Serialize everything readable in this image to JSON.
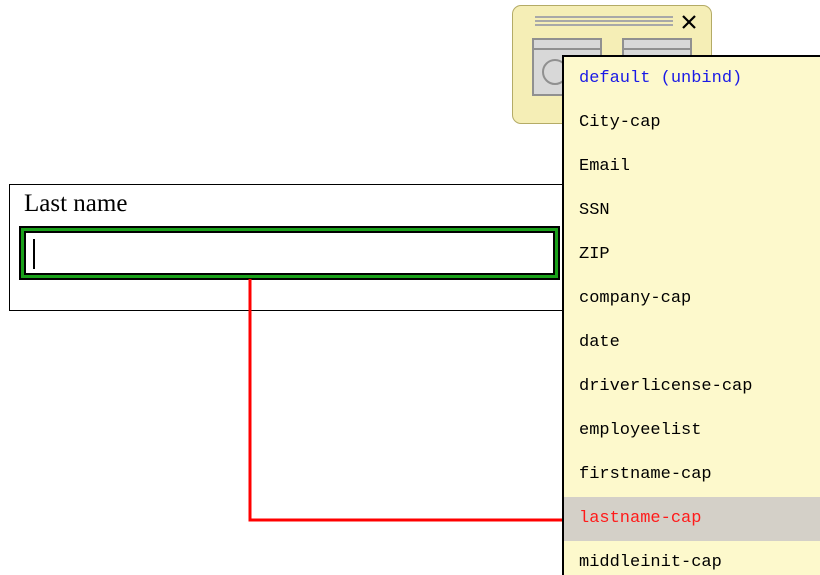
{
  "form": {
    "field_label": "Last name",
    "field_value": ""
  },
  "binding": {
    "line_color": "#ff0000",
    "field_highlight_color": "#19a019"
  },
  "palette": {
    "close_icon": "close-icon",
    "bg_color": "#f5eeb6"
  },
  "dropdown": {
    "items": [
      "default (unbind)",
      "City-cap",
      "Email",
      "SSN",
      "ZIP",
      "company-cap",
      "date",
      "driverlicense-cap",
      "employeelist",
      "firstname-cap",
      "lastname-cap",
      "middleinit-cap"
    ],
    "selected": "lastname-cap",
    "default_color": "#1a1ae6",
    "selected_color": "#ff1a1a",
    "selected_bg": "#d4d0c8"
  }
}
